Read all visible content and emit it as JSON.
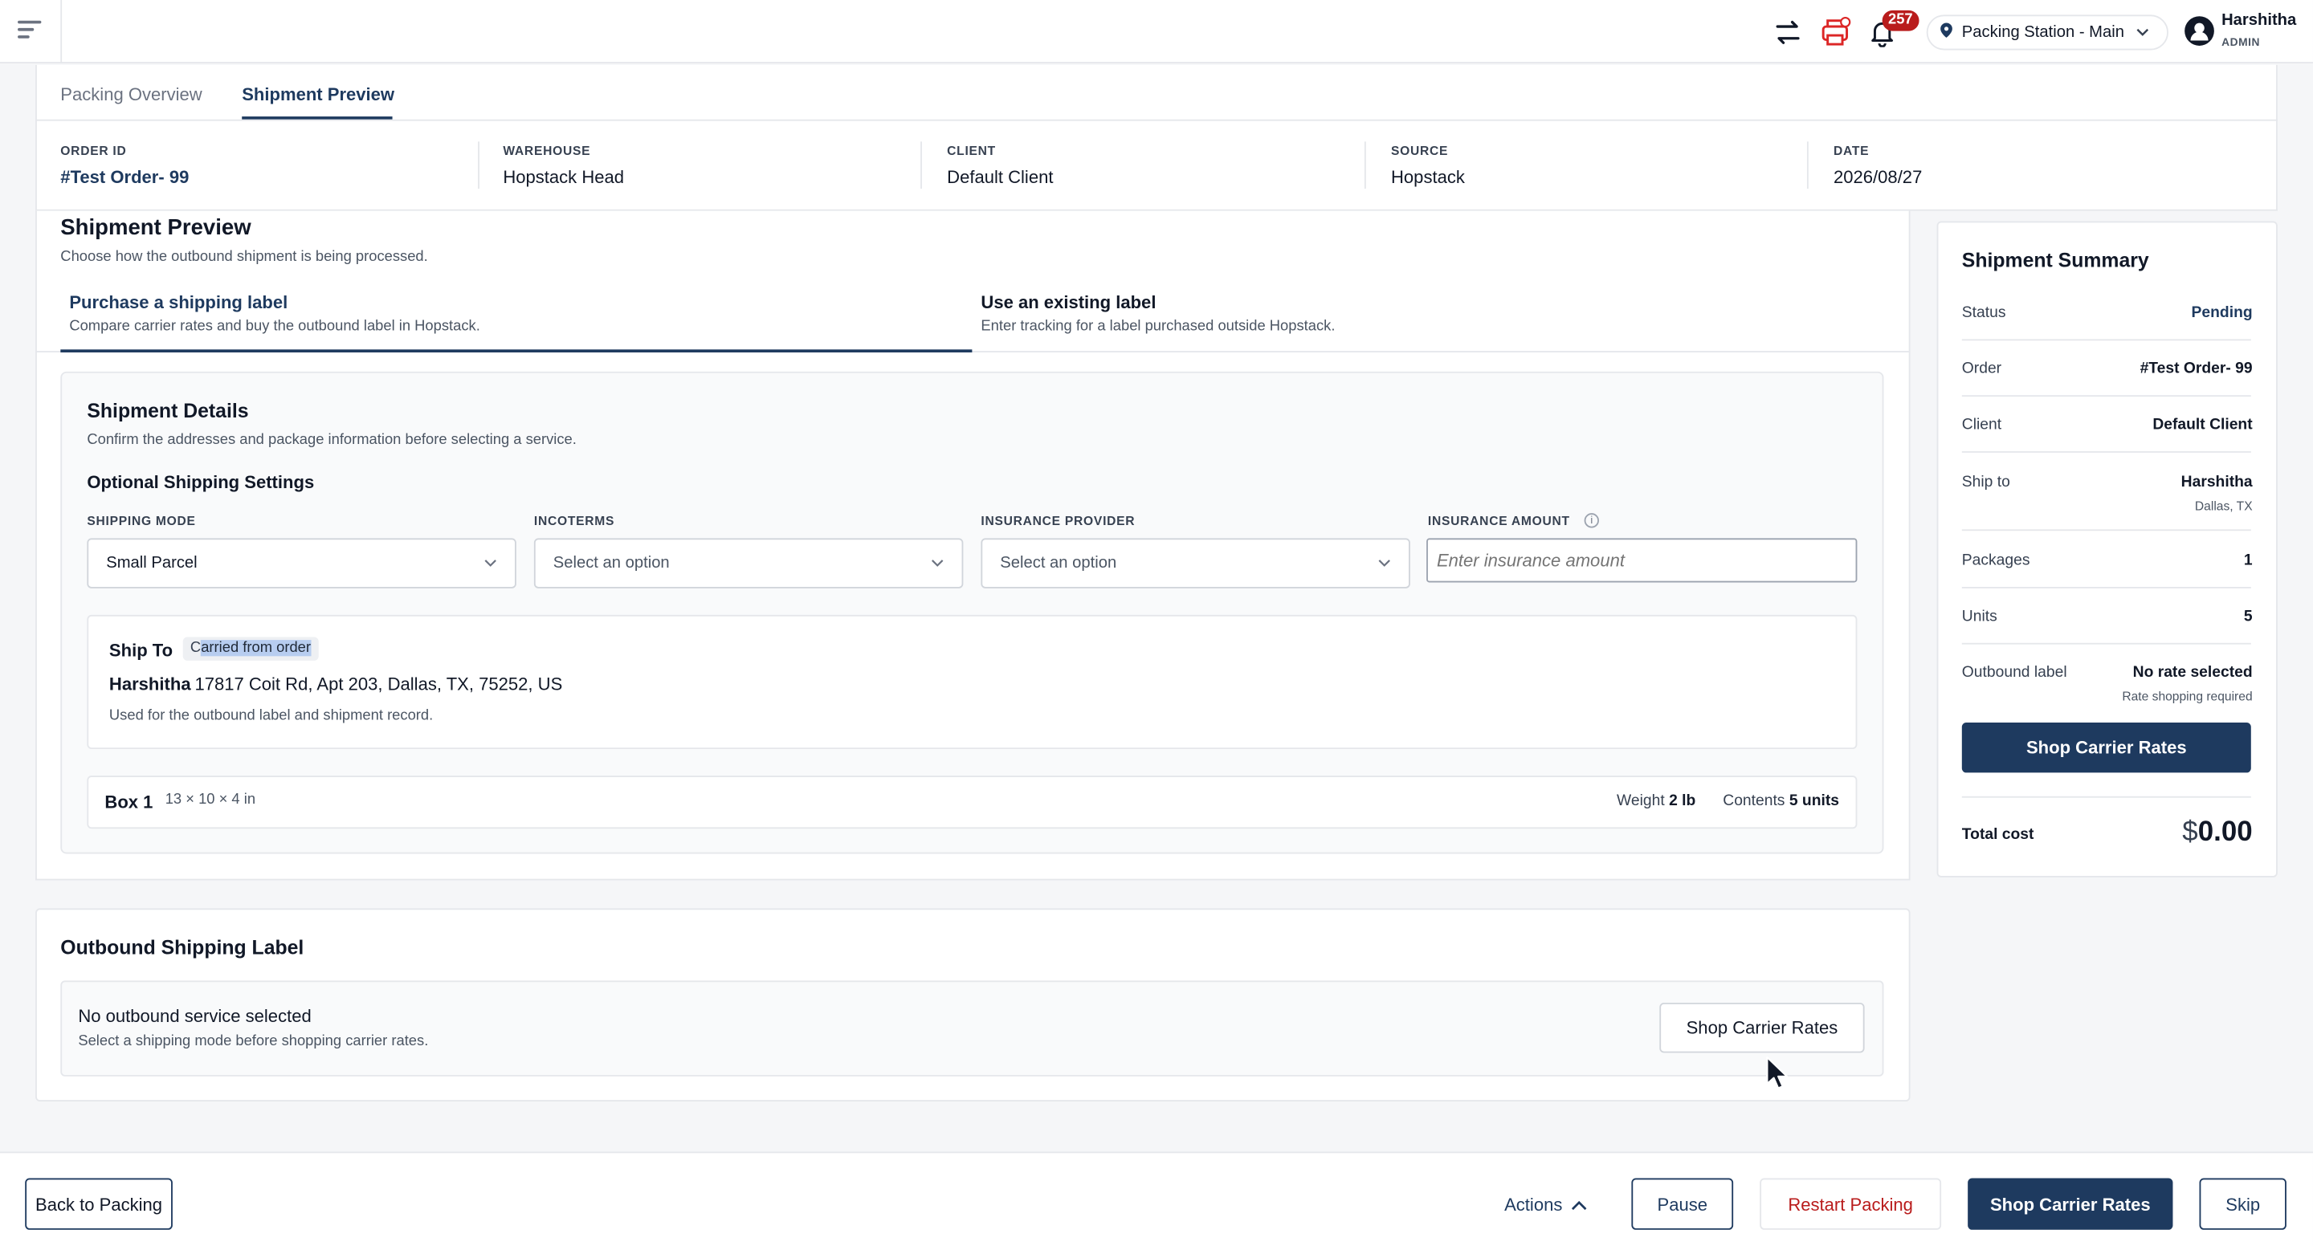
{
  "topbar": {
    "notification_count": "257",
    "station": "Packing Station - Main",
    "user_name": "Harshitha",
    "user_role": "ADMIN"
  },
  "tabs": [
    {
      "label": "Packing Overview",
      "active": false
    },
    {
      "label": "Shipment Preview",
      "active": true
    }
  ],
  "order_info": {
    "order_id_label": "ORDER ID",
    "order_id": "#Test Order- 99",
    "warehouse_label": "WAREHOUSE",
    "warehouse": "Hopstack Head",
    "client_label": "CLIENT",
    "client": "Default Client",
    "source_label": "SOURCE",
    "source": "Hopstack",
    "date_label": "DATE",
    "date": "2026/08/27"
  },
  "preview": {
    "title": "Shipment Preview",
    "subtitle": "Choose how the outbound shipment is being processed.",
    "options": [
      {
        "title": "Purchase a shipping label",
        "subtitle": "Compare carrier rates and buy the outbound label in Hopstack.",
        "active": true
      },
      {
        "title": "Use an existing label",
        "subtitle": "Enter tracking for a label purchased outside Hopstack.",
        "active": false
      }
    ]
  },
  "details": {
    "title": "Shipment Details",
    "subtitle": "Confirm the addresses and package information before selecting a service.",
    "optional_title": "Optional Shipping Settings",
    "shipping_mode_label": "SHIPPING MODE",
    "shipping_mode_value": "Small Parcel",
    "incoterms_label": "INCOTERMS",
    "incoterms_placeholder": "Select an option",
    "insurance_provider_label": "INSURANCE PROVIDER",
    "insurance_provider_placeholder": "Select an option",
    "insurance_amount_label": "INSURANCE AMOUNT",
    "insurance_amount_placeholder": "Enter insurance amount"
  },
  "ship_to": {
    "title": "Ship To",
    "tag_prefix": "C",
    "tag_highlight": "arried from order",
    "name": "Harshitha",
    "address": "17817 Coit Rd, Apt 203, Dallas, TX, 75252, US",
    "note": "Used for the outbound label and shipment record."
  },
  "box": {
    "name": "Box 1",
    "dims": "13 × 10 × 4 in",
    "weight_label": "Weight",
    "weight": "2 lb",
    "contents_label": "Contents",
    "contents": "5 units"
  },
  "outbound": {
    "title": "Outbound Shipping Label",
    "main": "No outbound service selected",
    "sub": "Select a shipping mode before shopping carrier rates.",
    "button": "Shop Carrier Rates"
  },
  "summary": {
    "title": "Shipment Summary",
    "status_label": "Status",
    "status": "Pending",
    "order_label": "Order",
    "order": "#Test Order- 99",
    "client_label": "Client",
    "client": "Default Client",
    "ship_to_label": "Ship to",
    "ship_to_name": "Harshitha",
    "ship_to_city": "Dallas, TX",
    "packages_label": "Packages",
    "packages": "1",
    "units_label": "Units",
    "units": "5",
    "outbound_label_label": "Outbound label",
    "outbound_label": "No rate selected",
    "outbound_label_note": "Rate shopping required",
    "button": "Shop Carrier Rates",
    "total_label": "Total cost",
    "total_currency": "$",
    "total_value": "0.00"
  },
  "footer": {
    "back": "Back to Packing",
    "actions": "Actions",
    "pause": "Pause",
    "restart": "Restart Packing",
    "shop": "Shop Carrier Rates",
    "skip": "Skip"
  },
  "colors": {
    "brand": "#1e3a5f",
    "danger": "#b91c1c",
    "highlight": "#b7cdf0"
  }
}
